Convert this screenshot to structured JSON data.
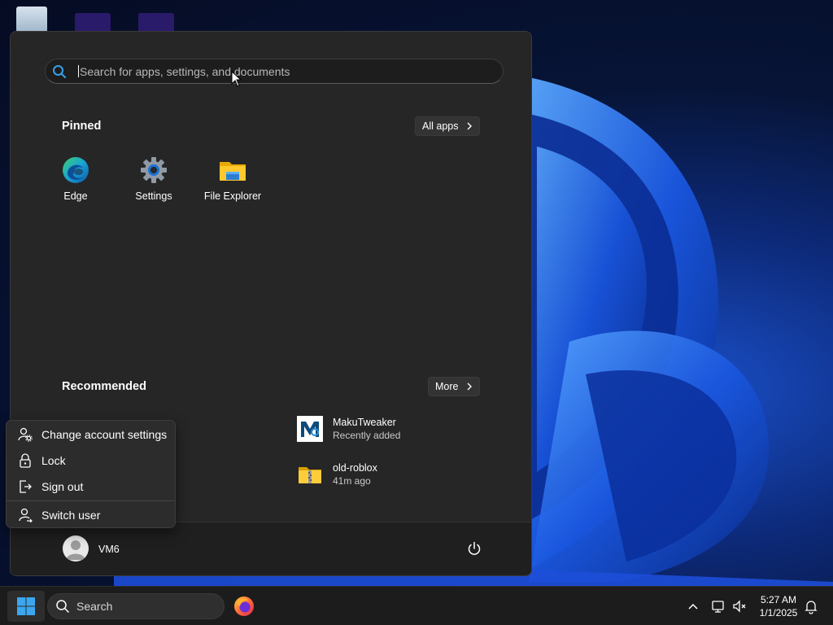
{
  "start_menu": {
    "search": {
      "placeholder": "Search for apps, settings, and documents"
    },
    "pinned": {
      "title": "Pinned",
      "all_apps_label": "All apps",
      "apps": [
        {
          "label": "Edge",
          "icon": "edge-icon"
        },
        {
          "label": "Settings",
          "icon": "gear-icon"
        },
        {
          "label": "File Explorer",
          "icon": "folder-icon"
        }
      ]
    },
    "recommended": {
      "title": "Recommended",
      "more_label": "More",
      "items": [
        {
          "name": "MakuTweaker",
          "subtitle": "Recently added",
          "icon": "makutweaker-icon"
        },
        {
          "name": "old-roblox",
          "subtitle": "41m ago",
          "icon": "zip-folder-icon"
        }
      ]
    },
    "footer": {
      "username": "VM6",
      "power_icon": "power-icon"
    }
  },
  "account_menu": {
    "items": [
      {
        "label": "Change account settings",
        "icon": "account-settings-icon"
      },
      {
        "label": "Lock",
        "icon": "lock-icon"
      },
      {
        "label": "Sign out",
        "icon": "sign-out-icon"
      },
      {
        "label": "Switch user",
        "icon": "switch-user-icon"
      }
    ]
  },
  "taskbar": {
    "search_label": "Search",
    "time": "5:27 AM",
    "date": "1/1/2025"
  },
  "colors": {
    "accent": "#0078d4",
    "menu_bg": "#262626",
    "taskbar_bg": "#1c1c1c"
  }
}
